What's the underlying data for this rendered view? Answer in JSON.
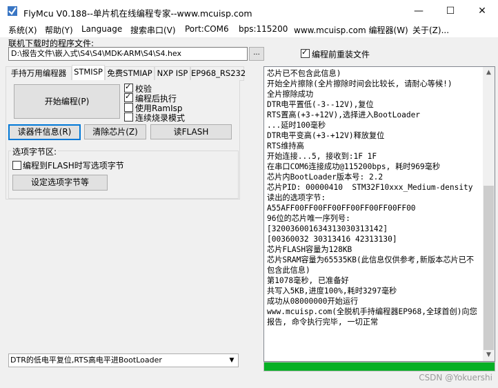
{
  "window": {
    "title": "FlyMcu V0.188--单片机在线编程专家--www.mcuisp.com",
    "minimize_glyph": "—",
    "maximize_glyph": "☐",
    "close_glyph": "✕"
  },
  "menu": [
    "系统(X)",
    "帮助(Y)",
    "Language",
    "搜索串口(V)",
    "Port:COM6",
    "bps:115200",
    "www.mcuisp.com 编程器(W)",
    "关于(Z)..."
  ],
  "file": {
    "label": "联机下载时的程序文件:",
    "path": "D:\\报告文件\\嵌入式\\S4\\S4\\MDK-ARM\\S4\\S4.hex",
    "browse_label": "...",
    "reload_label": "编程前重装文件",
    "reload_checked": true
  },
  "tabs": [
    "手持万用编程器",
    "STMISP",
    "免费STMIAP",
    "NXP ISP",
    "EP968_RS232"
  ],
  "active_tab": 1,
  "panel": {
    "start_button": "开始编程(P)",
    "options": [
      {
        "label": "校验",
        "checked": true
      },
      {
        "label": "编程后执行",
        "checked": true
      },
      {
        "label": "使用RamIsp",
        "checked": false
      },
      {
        "label": "连续烧录模式",
        "checked": false
      }
    ],
    "read_info_button": "读器件信息(R)",
    "erase_button": "清除芯片(Z)",
    "read_flash_button": "读FLASH",
    "option_group_title": "选项字节区:",
    "write_option_label": "编程到FLASH时写选项字节",
    "set_option_button": "设定选项字节等"
  },
  "reset_mode": "DTR的低电平复位,RTS高电平进BootLoader",
  "log_lines": [
    "芯片已不包含此信息)",
    "开始全片擦除(全片擦除时间会比较长, 请耐心等候!)",
    "全片擦除成功",
    "DTR电平置低(-3--12V),复位",
    "RTS置高(+3-+12V),选择进入BootLoader",
    "...延时100毫秒",
    "DTR电平变高(+3-+12V)释放复位",
    "RTS维持高",
    "开始连接...5, 接收到:1F 1F",
    "在串口COM6连接成功@115200bps, 耗时969毫秒",
    "芯片内BootLoader版本号: 2.2",
    "芯片PID: 00000410  STM32F10xxx_Medium-density",
    "读出的选项字节:",
    "A55AFF00FF00FF00FF00FF00FF00FF00",
    "96位的芯片唯一序列号:",
    "[3200360016343130303131​42]",
    "[00360032 30313416 42313130]",
    "芯片FLASH容量为128KB",
    "芯片SRAM容量为65535KB(此信息仅供参考,新版本芯片已不包含此信息)",
    "第1078毫秒, 已准备好",
    "共写入5KB,进度100%,耗时3297毫秒",
    "成功从08000000开始运行",
    "www.mcuisp.com(全脱机手持编程器EP968,全球首创)向您报告, 命令执行完毕, 一切正常"
  ],
  "progress_fraction": 1.0,
  "progress_color": "#06b025",
  "watermark": "CSDN @Yokuershi"
}
